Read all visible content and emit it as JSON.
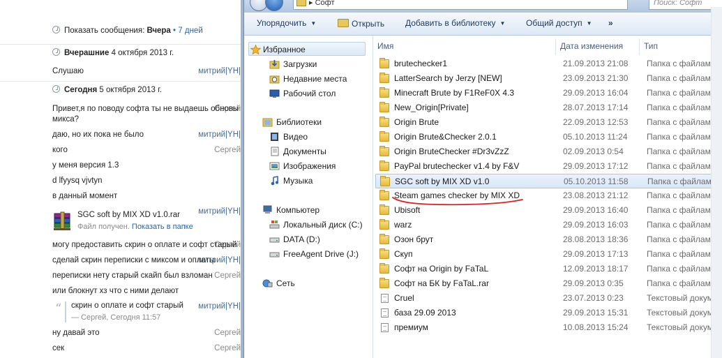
{
  "chat": {
    "history_bar": {
      "prefix": "Показать сообщения:",
      "period": "Вчера",
      "sep": "•",
      "link": "7 дней"
    },
    "day1": {
      "label": "Вчерашние",
      "date": "4 октября 2013 г."
    },
    "day2": {
      "label": "Сегодня",
      "date": "5 октября 2013 г."
    },
    "messages": [
      {
        "author": "митрий|YH|",
        "text": "Слушаю"
      },
      {
        "author": "Сергей",
        "text": "Привет,я по поводу софта ты не выдаешь обновы е"
      },
      {
        "author": "",
        "text": "микса?"
      },
      {
        "author": "митрий|YH|",
        "text": "даю, но их пока не было"
      },
      {
        "author": "Сергей",
        "text": "кого"
      },
      {
        "author": "",
        "text": "у меня версия 1.3"
      },
      {
        "author": "",
        "text": "d lfyysq vjvtyn"
      },
      {
        "author": "",
        "text": "в данный момент"
      },
      {
        "author": "Сергей",
        "text": "могу предоставить скрин о оплате и софт старый"
      },
      {
        "author": "митрий|YH|",
        "text": "сделай скрин переписки с миксом и оплаты"
      },
      {
        "author": "Сергей",
        "text": "переписки нету старый скайп был взломан"
      },
      {
        "author": "",
        "text": "или блокнут хз что с ними делают"
      },
      {
        "author": "Сергей",
        "text": "ну давай это"
      },
      {
        "author": "Сергей",
        "text": "сек"
      }
    ],
    "file_author": "митрий|YH|",
    "file": {
      "name": "SGC soft by MIX XD v1.0.rar",
      "status": "Файл получен.",
      "link": "Показать в папке"
    },
    "quote_author": "митрий|YH|",
    "quote": {
      "text": "скрин о оплате и софт старый",
      "meta": "— Сергей, Сегодня 11:57"
    }
  },
  "explorer": {
    "address": "Софт",
    "search_placeholder": "Поиск: Софт",
    "toolbar": {
      "organize": "Упорядочить",
      "open": "Открыть",
      "add_to_library": "Добавить в библиотеку",
      "share": "Общий доступ",
      "more": "»"
    },
    "nav": {
      "favorites": "Избранное",
      "downloads": "Загрузки",
      "recent": "Недавние места",
      "desktop": "Рабочий стол",
      "libraries": "Библиотеки",
      "video": "Видео",
      "documents": "Документы",
      "pictures": "Изображения",
      "music": "Музыка",
      "computer": "Компьютер",
      "local_disk": "Локальный диск (C:)",
      "data_disk": "DATA (D:)",
      "freeagent": "FreeAgent Drive (J:)",
      "network": "Сеть"
    },
    "columns": {
      "name": "Имя",
      "date": "Дата изменения",
      "type": "Тип"
    },
    "files": [
      {
        "name": "brutechecker1",
        "date": "21.09.2013 21:08",
        "type": "Папка с файлами",
        "kind": "folder"
      },
      {
        "name": "LatterSearch by Jerzy [NEW]",
        "date": "23.09.2013 21:30",
        "type": "Папка с файлами",
        "kind": "folder"
      },
      {
        "name": "Minecraft Brute by F1ReF0X 4.3",
        "date": "29.09.2013 16:04",
        "type": "Папка с файлами",
        "kind": "folder"
      },
      {
        "name": "New_Origin[Private]",
        "date": "28.07.2013 17:14",
        "type": "Папка с файлами",
        "kind": "folder"
      },
      {
        "name": "Origin Brute",
        "date": "22.09.2013 12:53",
        "type": "Папка с файлами",
        "kind": "folder"
      },
      {
        "name": "Origin Brute&Checker 2.0.1",
        "date": "05.10.2013 11:24",
        "type": "Папка с файлами",
        "kind": "folder"
      },
      {
        "name": "Origin BruteChecker #Dr3vZzZ",
        "date": "02.09.2013 0:54",
        "type": "Папка с файлами",
        "kind": "folder"
      },
      {
        "name": "PayPal brutechecker v1.4 by F&V",
        "date": "29.09.2013 17:12",
        "type": "Папка с файлами",
        "kind": "folder"
      },
      {
        "name": "SGC soft by MIX XD v1.0",
        "date": "05.10.2013 11:58",
        "type": "Папка с файлами",
        "kind": "folder",
        "selected": true
      },
      {
        "name": "Steam games checker by MIX XD",
        "date": "23.08.2013 21:12",
        "type": "Папка с файлами",
        "kind": "folder"
      },
      {
        "name": "Ubisoft",
        "date": "29.09.2013 16:40",
        "type": "Папка с файлами",
        "kind": "folder"
      },
      {
        "name": "warz",
        "date": "29.09.2013 16:03",
        "type": "Папка с файлами",
        "kind": "folder"
      },
      {
        "name": "Озон брут",
        "date": "28.08.2013 18:36",
        "type": "Папка с файлами",
        "kind": "folder"
      },
      {
        "name": "Скуп",
        "date": "29.09.2013 17:13",
        "type": "Папка с файлами",
        "kind": "folder"
      },
      {
        "name": "Софт на Origin by FaTaL",
        "date": "12.09.2013 18:17",
        "type": "Папка с файлами",
        "kind": "folder"
      },
      {
        "name": "Софт на БК by FaTaL.rar",
        "date": "29.09.2013 0:35",
        "type": "Папка с файлами",
        "kind": "folder"
      },
      {
        "name": "Cruel",
        "date": "23.07.2013 0:23",
        "type": "Текстовый докум...",
        "kind": "doc"
      },
      {
        "name": "база 29.09 2013",
        "date": "29.09.2013 15:31",
        "type": "Текстовый докум...",
        "kind": "doc"
      },
      {
        "name": "премиум",
        "date": "10.08.2013 15:24",
        "type": "Текстовый докум...",
        "kind": "doc"
      }
    ],
    "colors": {
      "annotation": "#e02020",
      "selection": "#d8e7f8"
    }
  }
}
